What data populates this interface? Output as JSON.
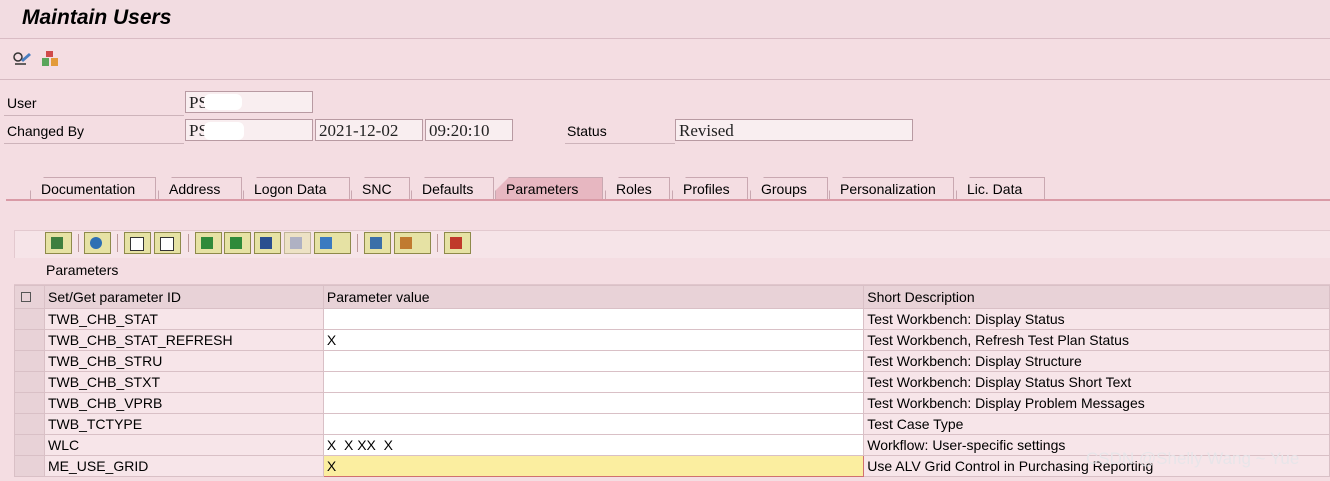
{
  "title": "Maintain Users",
  "app_toolbar": {
    "icons": [
      "display-change-icon",
      "transport-icon"
    ]
  },
  "header": {
    "user_label": "User",
    "user_value": "PS",
    "changed_by_label": "Changed By",
    "changed_by_value": "PS",
    "date": "2021-12-02",
    "time": "09:20:10",
    "status_label": "Status",
    "status_value": "Revised"
  },
  "tabs": [
    {
      "label": "Documentation"
    },
    {
      "label": "Address"
    },
    {
      "label": "Logon Data"
    },
    {
      "label": "SNC"
    },
    {
      "label": "Defaults"
    },
    {
      "label": "Parameters",
      "active": true
    },
    {
      "label": "Roles"
    },
    {
      "label": "Profiles"
    },
    {
      "label": "Groups"
    },
    {
      "label": "Personalization"
    },
    {
      "label": "Lic. Data"
    }
  ],
  "grid": {
    "caption": "Parameters",
    "columns": [
      "Set/Get parameter ID",
      "Parameter value",
      "Short Description"
    ],
    "rows": [
      {
        "id": "TWB_CHB_STAT",
        "value": "",
        "desc": "Test Workbench: Display Status"
      },
      {
        "id": "TWB_CHB_STAT_REFRESH",
        "value": "X",
        "desc": "Test Workbench, Refresh Test Plan Status"
      },
      {
        "id": "TWB_CHB_STRU",
        "value": "",
        "desc": "Test Workbench: Display Structure"
      },
      {
        "id": "TWB_CHB_STXT",
        "value": "",
        "desc": "Test Workbench: Display Status Short Text"
      },
      {
        "id": "TWB_CHB_VPRB",
        "value": "",
        "desc": "Test Workbench: Display Problem Messages"
      },
      {
        "id": "TWB_TCTYPE",
        "value": "",
        "desc": "Test Case Type"
      },
      {
        "id": "WLC",
        "value": "X  X XX  X",
        "desc": "Workflow: User-specific settings"
      },
      {
        "id": "ME_USE_GRID",
        "value": "X",
        "desc": "Use ALV Grid Control in Purchasing Reporting"
      }
    ]
  },
  "grid_toolbar_icons": [
    "details-icon",
    "refresh-icon",
    "copy-row-icon",
    "paste-row-icon",
    "sort-asc-icon",
    "sort-desc-icon",
    "find-icon",
    "find-next-icon",
    "filter-icon",
    "print-icon",
    "layout-icon",
    "delete-row-icon"
  ],
  "watermark": "CSDN @Shelly Wang ~ Yue"
}
